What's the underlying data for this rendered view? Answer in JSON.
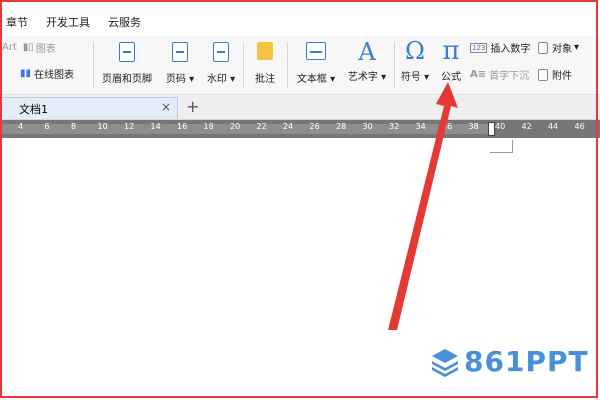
{
  "menu": {
    "items": [
      "章节",
      "开发工具",
      "云服务"
    ]
  },
  "ribbon": {
    "art_label": "Art",
    "chart_label": "图表",
    "online_chart_label": "在线图表",
    "header_footer_label": "页眉和页脚",
    "page_num_label": "页码",
    "watermark_label": "水印",
    "comment_label": "批注",
    "textbox_label": "文本框",
    "wordart_label": "艺术字",
    "symbol_label": "符号",
    "formula_label": "公式",
    "insert_number_label": "插入数字",
    "object_label": "对象",
    "dropcap_label": "首字下沉",
    "attachment_label": "附件",
    "dropdown_glyph": "▾",
    "omega_glyph": "Ω",
    "pi_glyph": "π",
    "a_glyph": "A",
    "num_glyph": "123"
  },
  "tabs": {
    "doc_name": "文档1",
    "close_glyph": "×",
    "add_glyph": "+"
  },
  "ruler": {
    "ticks": [
      "4",
      "6",
      "8",
      "10",
      "12",
      "14",
      "16",
      "18",
      "20",
      "22",
      "24",
      "26",
      "28",
      "30",
      "32",
      "34",
      "36",
      "38",
      "40",
      "42",
      "44",
      "46"
    ]
  },
  "watermark": {
    "text": "861PPT"
  },
  "colors": {
    "accent": "#3a7bd5",
    "arrow": "#e53935",
    "watermark": "#4a90d9"
  }
}
